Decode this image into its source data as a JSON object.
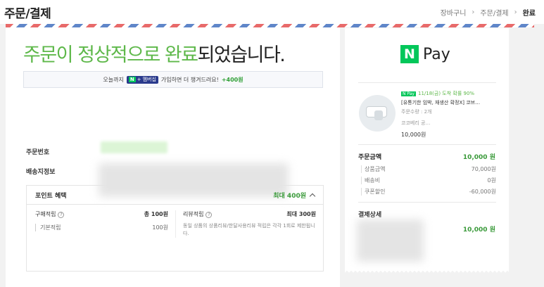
{
  "header": {
    "title": "주문/결제",
    "breadcrumbs": [
      "장바구니",
      "주문/결제",
      "완료"
    ]
  },
  "main": {
    "headline_green": "주문이 정상적으로 완료",
    "headline_rest": "되었습니다.",
    "promo": {
      "prefix": "오늘까지",
      "badge_n": "N",
      "badge_plus": "+",
      "badge_text": "멤버십",
      "text": "가입하면 더 챙겨드려요!",
      "points": "+400원"
    },
    "order_number_label": "주문번호",
    "shipping_label": "배송지정보",
    "benefit": {
      "title": "포인트 혜택",
      "max": "최대 400원",
      "purchase": {
        "label": "구매적립",
        "q": "?",
        "amount": "총 100원",
        "sub_label": "기본적립",
        "sub_amount": "100원"
      },
      "review": {
        "label": "리뷰적립",
        "q": "?",
        "amount": "최대 300원",
        "note": "동일 상품의 상품리뷰/한달사용리뷰 적립은 각각 1회로 제한됩니다."
      }
    }
  },
  "side": {
    "logo_n": "N",
    "logo_pay": "Pay",
    "product": {
      "tag": "N Pay",
      "delivery": "11/18(금) 도착 확률 90%",
      "name": "[유통기한 임박, 재생산 확정X] 코브…",
      "option": "주문수량 : 2개",
      "seller": "코코베리 공…",
      "price": "10,000원"
    },
    "order_amount": {
      "title": "주문금액",
      "total": "10,000 원",
      "items": [
        {
          "label": "상품금액",
          "value": "70,000원"
        },
        {
          "label": "배송비",
          "value": "0원"
        },
        {
          "label": "쿠폰할인",
          "value": "-60,000원"
        }
      ]
    },
    "payment": {
      "title": "결제상세",
      "amount": "10,000 원"
    }
  }
}
